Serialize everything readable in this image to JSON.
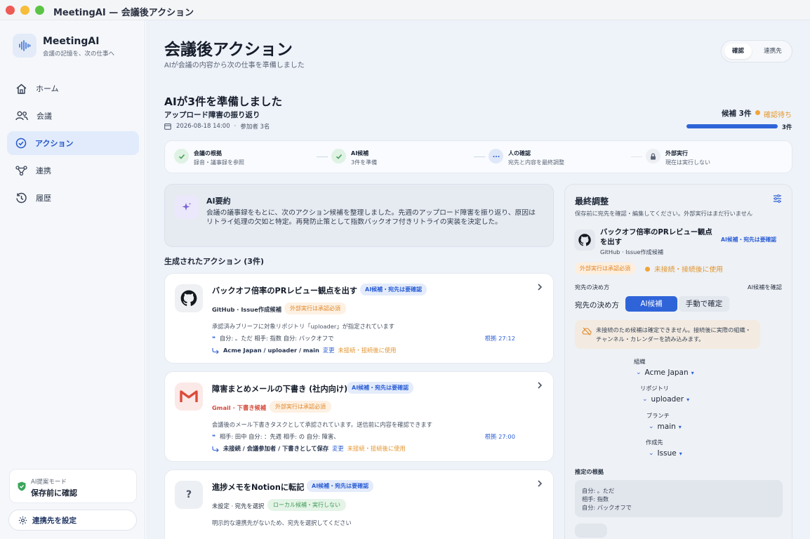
{
  "window": {
    "title": "MeetingAI — 会議後アクション"
  },
  "sidebar": {
    "brand_name": "MeetingAI",
    "brand_tagline": "会議の記憶を、次の仕事へ",
    "items": [
      {
        "label": "ホーム",
        "icon": "home-icon"
      },
      {
        "label": "会議",
        "icon": "people-icon"
      },
      {
        "label": "アクション",
        "icon": "check-circle-icon",
        "active": true
      },
      {
        "label": "連携",
        "icon": "network-icon"
      },
      {
        "label": "履歴",
        "icon": "history-icon"
      }
    ],
    "mode_label": "AI提案モード",
    "mode_value": "保存前に確認",
    "config_button": "連携先を設定"
  },
  "header": {
    "title": "会議後アクション",
    "subtitle": "AIが会議の内容から次の仕事を準備しました",
    "segment": [
      "確認",
      "連携先"
    ]
  },
  "summary": {
    "prepared_title": "AIが3件を準備しました",
    "meeting_title": "アップロード障害の振り返り",
    "meeting_datetime": "2026-08-18 14:00",
    "participants": "参加者 3名",
    "candidates_label": "候補 3件",
    "status_label": "確認待ち",
    "progress_label": "3件",
    "progress": 1.0
  },
  "steps": [
    {
      "title": "会議の根拠",
      "sub": "録音・議事録を参照",
      "state": "done"
    },
    {
      "title": "AI候補",
      "sub": "3件を準備",
      "state": "done"
    },
    {
      "title": "人の確認",
      "sub": "宛先と内容を最終調整",
      "state": "current"
    },
    {
      "title": "外部実行",
      "sub": "現在は実行しない",
      "state": "locked"
    }
  ],
  "ai_summary": {
    "title": "AI要約",
    "body": "会議の議事録をもとに、次のアクション候補を整理しました。先週のアップロード障害を振り返り、原因はリトライ処理の欠如と特定。再発防止策として指数バックオフ付きリトライの実装を決定した。"
  },
  "generated_title": "生成されたアクション (3件)",
  "actions": [
    {
      "title": "バックオフ倍率のPRレビュー観点を出す",
      "badge": "AI候補・宛先は要確認",
      "source": "GitHub · Issue作成候補",
      "status_badge": "外部実行は承認必須",
      "desc": "承認済みブリーフに対象リポジトリ「uploader」が指定されています",
      "quote": "自分: 。ただ 相手: 指数 自分: バックオフで",
      "timestamp": "根拠 27:12",
      "dest": "Acme Japan / uploader / main",
      "change": "変更",
      "warn": "未接続・接続後に使用"
    },
    {
      "title": "障害まとめメールの下書き (社内向け)",
      "badge": "AI候補・宛先は要確認",
      "source": "Gmail · 下書き候補",
      "status_badge": "外部実行は承認必須",
      "desc": "会議後のメール下書きタスクとして承認されています。送信前に内容を確認できます",
      "quote": "相手: 田中 自分: ：先週 相手: の 自分: 障害、",
      "timestamp": "根拠 27:00",
      "dest": "未接続 / 会議参加者 / 下書きとして保存",
      "change": "変更",
      "warn": "未接続・接続後に使用"
    },
    {
      "title": "進捗メモをNotionに転記",
      "badge": "AI候補・宛先は要確認",
      "source": "未設定 · 宛先を選択",
      "status_badge": "ローカル候補・実行しない",
      "desc": "明示的な連携先がないため、宛先を選択してください"
    }
  ],
  "panel": {
    "title": "最終調整",
    "subtitle": "保存前に宛先を確認・編集してください。外部実行はまだ行いません",
    "action_title": "バックオフ倍率のPRレビュー観点を出す",
    "action_source": "GitHub · Issue作成候補",
    "action_badge": "AI候補・宛先は要確認",
    "ext_badge": "外部実行は承認必須",
    "unconnected": "未接続・接続後に使用",
    "dest_label": "宛先の決め方",
    "dest_note": "AI候補を確認",
    "tab_label": "宛先の決め方",
    "tab_ai": "AI候補",
    "tab_manual": "手動で確定",
    "warning": "未接続のため候補は確定できません。接続後に実際の組織・チャンネル・カレンダーを読み込みます。",
    "tree": [
      {
        "label": "組織",
        "value": "Acme Japan"
      },
      {
        "label": "リポジトリ",
        "value": "uploader"
      },
      {
        "label": "ブランチ",
        "value": "main"
      },
      {
        "label": "作成先",
        "value": "Issue"
      }
    ],
    "basis_title": "推定の根拠",
    "basis_lines": [
      "自分: 。ただ",
      "相手: 指数",
      "自分: バックオフで"
    ]
  },
  "colors": {
    "accent": "#2f64d9",
    "warning": "#e59a2f",
    "success": "#3e9a55"
  }
}
